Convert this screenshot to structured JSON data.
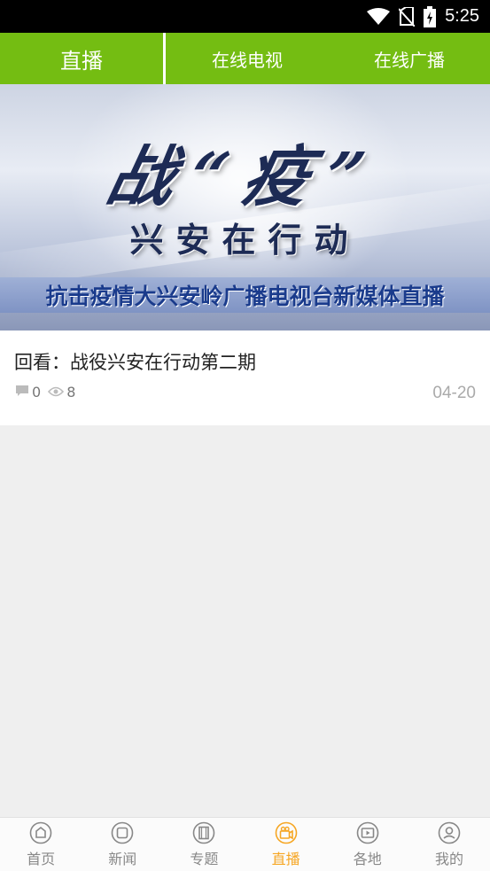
{
  "status_bar": {
    "time": "5:25",
    "icons": [
      "wifi-icon",
      "no-sim-icon",
      "battery-charging-icon"
    ]
  },
  "tabs": {
    "items": [
      {
        "label": "直播",
        "active": true
      },
      {
        "label": "在线电视",
        "active": false
      },
      {
        "label": "在线广播",
        "active": false
      }
    ]
  },
  "banner": {
    "big_title": "战“疫”",
    "sub_title": "兴安在行动",
    "strip_text": "抗击疫情大兴安岭广播电视台新媒体直播"
  },
  "news": {
    "title": "回看：战役兴安在行动第二期",
    "comments": "0",
    "views": "8",
    "date": "04-20"
  },
  "bottom_nav": {
    "items": [
      {
        "label": "首页",
        "icon": "home-icon",
        "active": false
      },
      {
        "label": "新闻",
        "icon": "news-icon",
        "active": false
      },
      {
        "label": "专题",
        "icon": "film-icon",
        "active": false
      },
      {
        "label": "直播",
        "icon": "video-camera-icon",
        "active": true
      },
      {
        "label": "各地",
        "icon": "local-video-icon",
        "active": false
      },
      {
        "label": "我的",
        "icon": "user-icon",
        "active": false
      }
    ]
  },
  "colors": {
    "accent_green": "#74bd12",
    "active_orange": "#f6a623",
    "inactive_gray": "#888888"
  }
}
